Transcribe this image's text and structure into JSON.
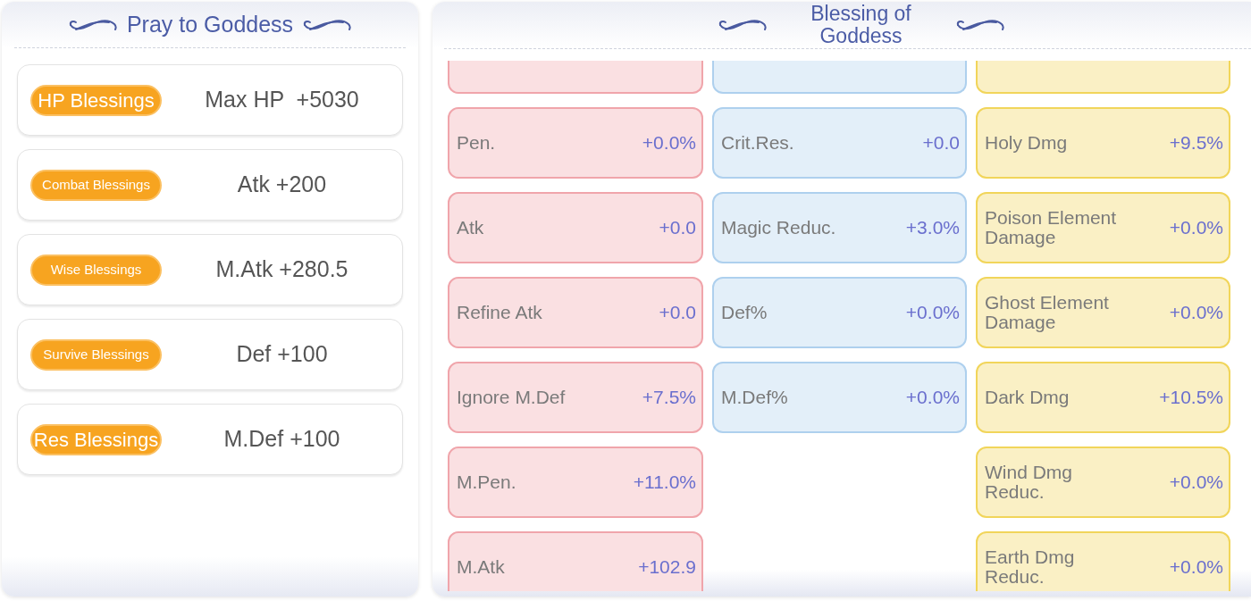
{
  "pray_panel": {
    "title": "Pray to Goddess",
    "blessings": [
      {
        "badge": "HP Blessings",
        "bonus": "Max HP  +5030"
      },
      {
        "badge": "Combat Blessings",
        "bonus": "Atk +200"
      },
      {
        "badge": "Wise Blessings",
        "bonus": "M.Atk +280.5"
      },
      {
        "badge": "Survive Blessings",
        "bonus": "Def +100"
      },
      {
        "badge": "Res Blessings",
        "bonus": "M.Def +100"
      }
    ]
  },
  "blessing_panel": {
    "title": "Blessing of Goddess",
    "columns": [
      {
        "color": "#f0a5ab",
        "cards": [
          {
            "kind": "partial"
          },
          {
            "kind": "stat",
            "label": "Pen.",
            "value": "+0.0%"
          },
          {
            "kind": "stat",
            "label": "Atk",
            "value": "+0.0"
          },
          {
            "kind": "stat",
            "label": "Refine Atk",
            "value": "+0.0"
          },
          {
            "kind": "stat",
            "label": "Ignore M.Def",
            "value": "+7.5%"
          },
          {
            "kind": "stat",
            "label": "M.Pen.",
            "value": "+11.0%"
          },
          {
            "kind": "stat",
            "label": "M.Atk",
            "value": "+102.9"
          }
        ]
      },
      {
        "color": "#aed0ee",
        "cards": [
          {
            "kind": "partial"
          },
          {
            "kind": "stat",
            "label": "Crit.Res.",
            "value": "+0.0"
          },
          {
            "kind": "stat",
            "label": "Magic Reduc.",
            "value": "+3.0%"
          },
          {
            "kind": "stat",
            "label": "Def%",
            "value": "+0.0%"
          },
          {
            "kind": "stat",
            "label": "M.Def%",
            "value": "+0.0%"
          }
        ]
      },
      {
        "color": "#f1d55a",
        "cards": [
          {
            "kind": "partial"
          },
          {
            "kind": "stat",
            "label": "Holy Dmg",
            "value": "+9.5%"
          },
          {
            "kind": "stat",
            "label": "Poison Element Damage",
            "value": "+0.0%"
          },
          {
            "kind": "stat",
            "label": "Ghost Element Damage",
            "value": "+0.0%"
          },
          {
            "kind": "stat",
            "label": "Dark Dmg",
            "value": "+10.5%"
          },
          {
            "kind": "stat",
            "label": "Wind Dmg Reduc.",
            "value": "+0.0%"
          },
          {
            "kind": "stat",
            "label": "Earth Dmg Reduc.",
            "value": "+0.0%"
          }
        ]
      }
    ]
  }
}
